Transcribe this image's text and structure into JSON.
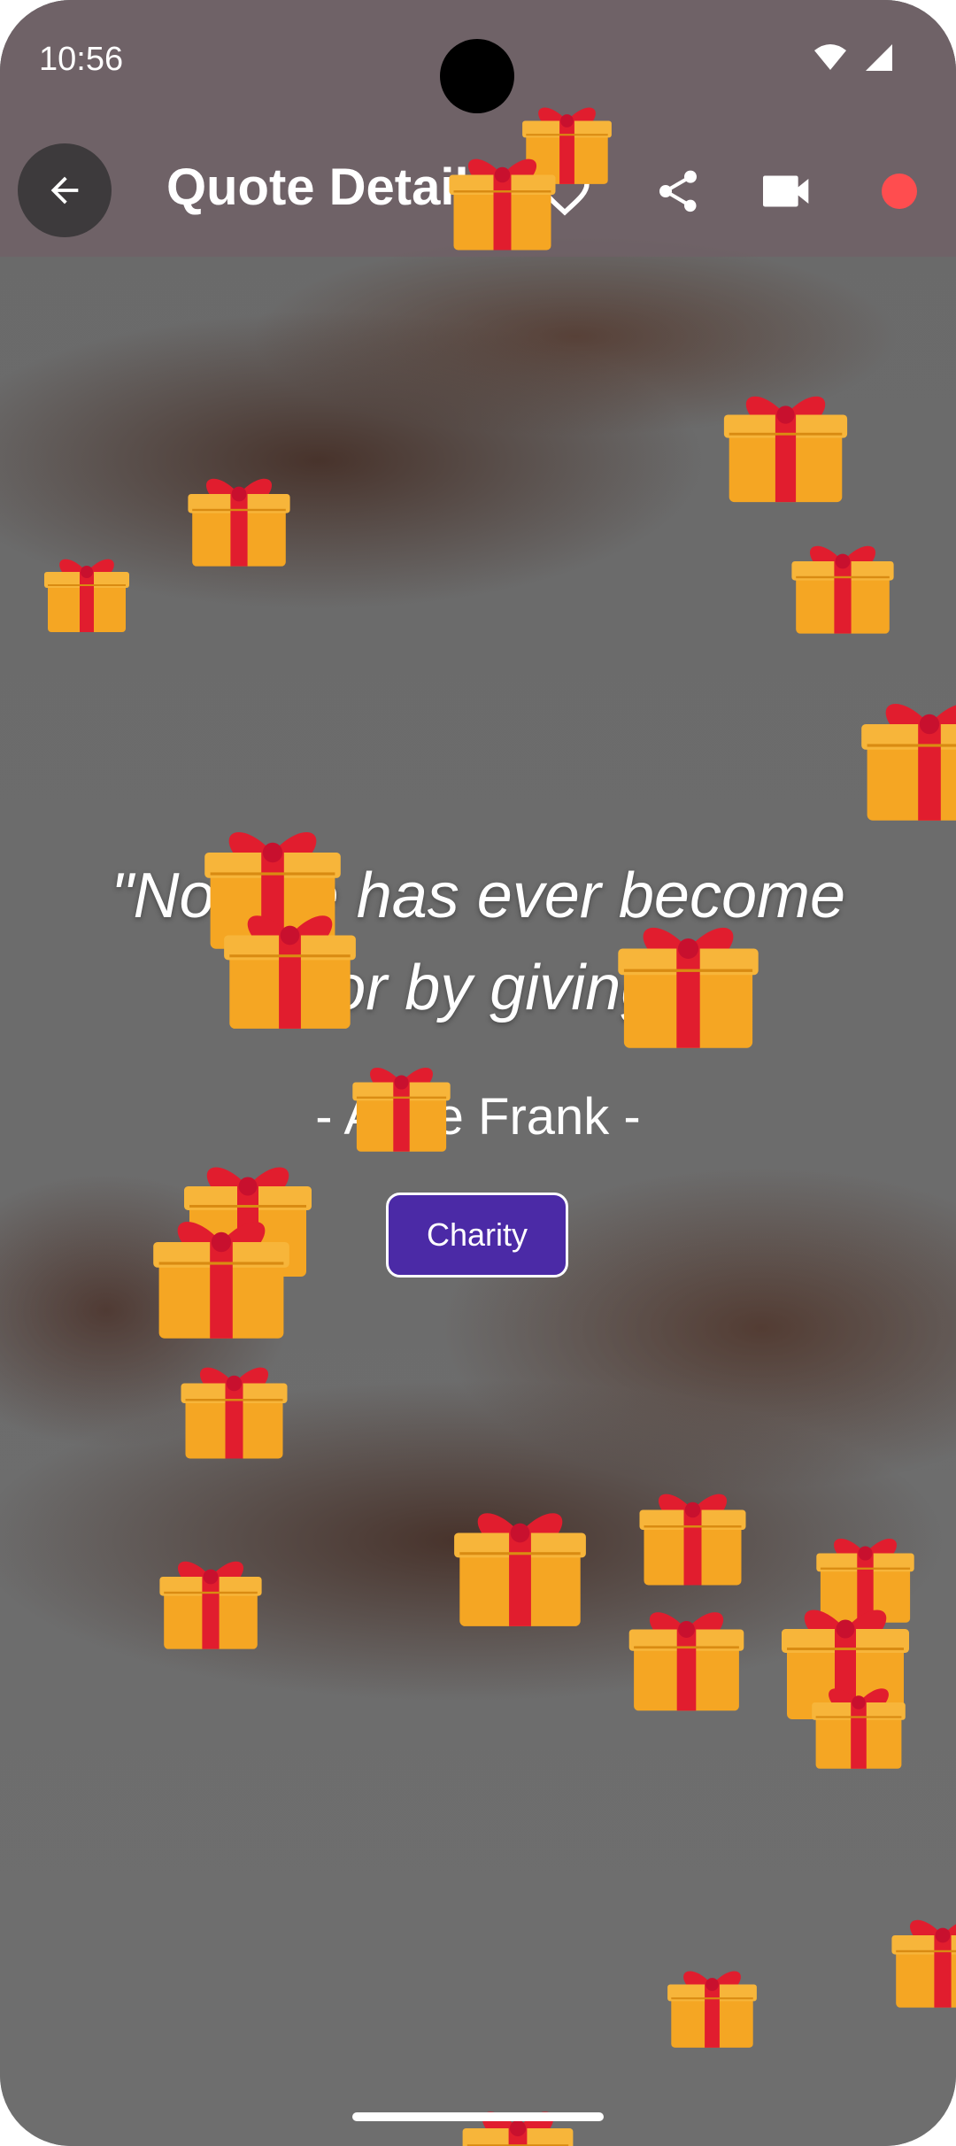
{
  "status_bar": {
    "time": "10:56"
  },
  "app_bar": {
    "title": "Quote Detail",
    "back_icon": "arrow-back-icon",
    "actions": [
      "heart-outline-icon",
      "share-icon",
      "video-camera-icon",
      "record-dot-icon"
    ]
  },
  "quote": {
    "text": "\"No one has ever become poor by giving.\"",
    "author": "- Anne Frank -",
    "tag": "Charity"
  },
  "colors": {
    "appbar": "#706066",
    "tag_chip": "#4b2aa6",
    "record_dot": "#ff4d4f",
    "gift_box": "#f5a623",
    "gift_ribbon": "#e11d2e"
  },
  "decoration": {
    "gift_icon": "gift-box-icon"
  }
}
